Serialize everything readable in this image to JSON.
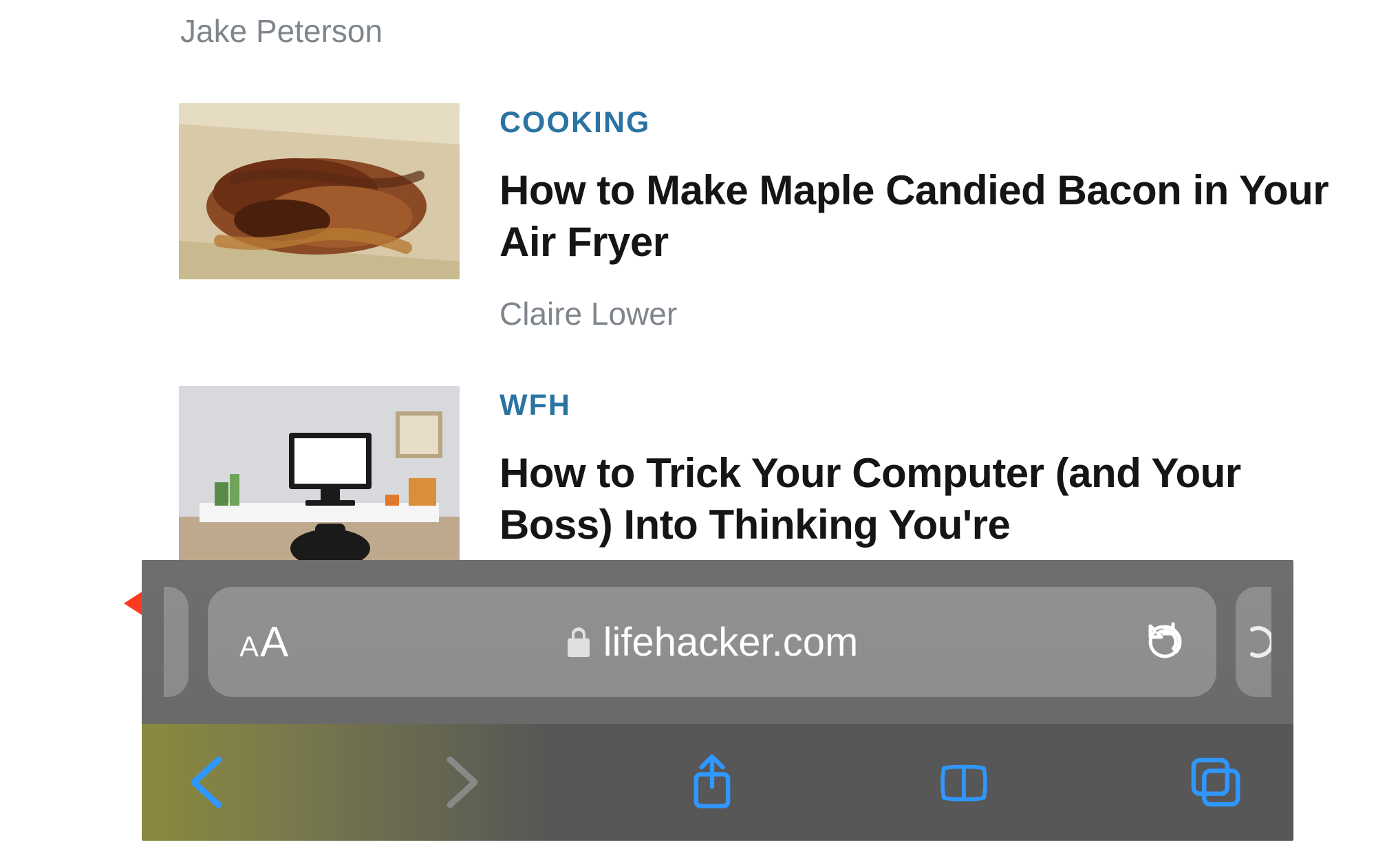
{
  "top_author": "Jake Peterson",
  "articles": [
    {
      "category": "COOKING",
      "title": "How to Make Maple Candied Bacon in Your Air Fryer",
      "author": "Claire Lower",
      "thumb": "bacon"
    },
    {
      "category": "WFH",
      "title": "How to Trick Your Computer (and Your Boss) Into Thinking You're",
      "author": "",
      "thumb": "desk"
    }
  ],
  "browser": {
    "url_label": "lifehacker.com",
    "text_size_label_small": "A",
    "text_size_label_big": "A"
  },
  "annotations": {
    "arrow_left": "swipe-left-hint",
    "arrow_right": "swipe-right-hint"
  },
  "colors": {
    "category": "#2a73a3",
    "accent_blue": "#2f97ff",
    "arrow": "#ff3b1f"
  }
}
